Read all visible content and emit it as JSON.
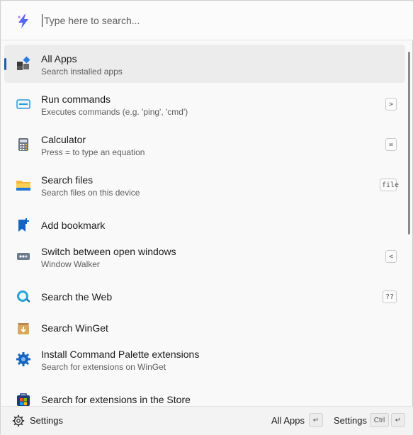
{
  "search": {
    "placeholder": "Type here to search..."
  },
  "items": [
    {
      "title": "All Apps",
      "subtitle": "Search installed apps",
      "icon": "all-apps-icon",
      "selected": true,
      "shortcut": ""
    },
    {
      "title": "Run commands",
      "subtitle": "Executes commands (e.g. 'ping', 'cmd')",
      "icon": "terminal-icon",
      "shortcut": ">"
    },
    {
      "title": "Calculator",
      "subtitle": "Press = to type an equation",
      "icon": "calculator-icon",
      "shortcut": "="
    },
    {
      "title": "Search files",
      "subtitle": "Search files on this device",
      "icon": "folder-icon",
      "shortcut": "file"
    },
    {
      "title": "Add bookmark",
      "subtitle": "",
      "icon": "bookmark-add-icon",
      "shortcut": ""
    },
    {
      "title": "Switch between open windows",
      "subtitle": "Window Walker",
      "icon": "window-walker-icon",
      "shortcut": "<"
    },
    {
      "title": "Search the Web",
      "subtitle": "",
      "icon": "web-search-icon",
      "shortcut": "??"
    },
    {
      "title": "Search WinGet",
      "subtitle": "",
      "icon": "winget-icon",
      "shortcut": ""
    },
    {
      "title": "Install Command Palette extensions",
      "subtitle": "Search for extensions on WinGet",
      "icon": "extension-gear-icon",
      "shortcut": ""
    },
    {
      "title": "Search for extensions in the Store",
      "subtitle": "",
      "icon": "store-icon",
      "shortcut": ""
    }
  ],
  "footer": {
    "settings_label": "Settings",
    "primary_action": "All Apps",
    "enter_key": "↵",
    "secondary_action": "Settings",
    "ctrl_key": "Ctrl",
    "enter_key2": "↵"
  },
  "colors": {
    "accent": "#1a5dab",
    "selected_bg": "#ececec"
  }
}
